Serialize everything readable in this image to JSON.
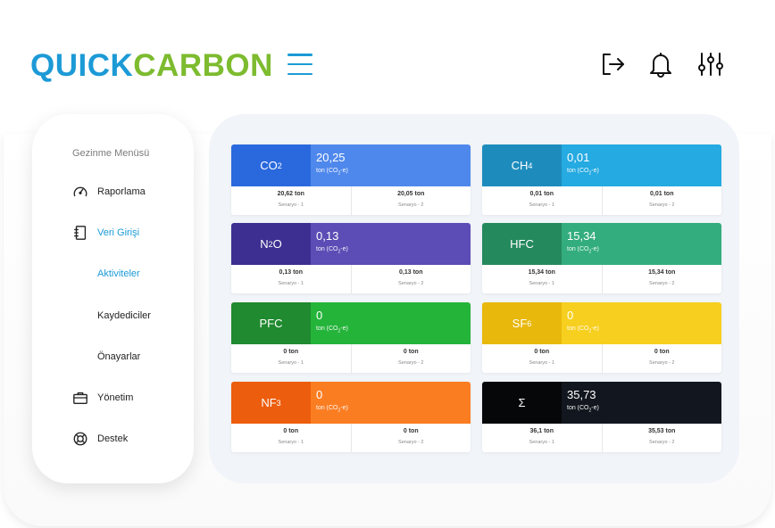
{
  "brand": {
    "part1": "QUICK",
    "part2": "CARBON",
    "color1": "#1c9ad6",
    "color2": "#7dbb2f"
  },
  "header_icons": [
    "logout-icon",
    "bell-icon",
    "sliders-icon"
  ],
  "sidebar": {
    "title": "Gezinme Menüsü",
    "items": [
      {
        "label": "Raporlama",
        "icon": "speedometer-icon"
      },
      {
        "label": "Veri Girişi",
        "icon": "notebook-icon"
      },
      {
        "label": "Aktiviteler"
      },
      {
        "label": "Kaydediciler"
      },
      {
        "label": "Önayarlar"
      },
      {
        "label": "Yönetim",
        "icon": "briefcase-icon"
      },
      {
        "label": "Destek",
        "icon": "lifebuoy-icon"
      }
    ]
  },
  "unit": "ton (CO₂-e)",
  "scenario1": "Senaryo - 1",
  "scenario2": "Senaryo - 2",
  "cards": [
    {
      "name": "CO",
      "sub": "2",
      "value": "20,25",
      "s1": "20,62 ton",
      "s2": "20,05 ton",
      "dark": "#2a69dd",
      "light": "#4f88ec"
    },
    {
      "name": "CH",
      "sub": "4",
      "value": "0,01",
      "s1": "0,01 ton",
      "s2": "0,01 ton",
      "dark": "#1d8cbd",
      "light": "#25aae1"
    },
    {
      "name": "N",
      "sub": "2",
      "name2": "O",
      "value": "0,13",
      "s1": "0,13 ton",
      "s2": "0,13 ton",
      "dark": "#3c2f91",
      "light": "#5b4db5"
    },
    {
      "name": "HFC",
      "value": "15,34",
      "s1": "15,34 ton",
      "s2": "15,34 ton",
      "dark": "#25895e",
      "light": "#33ad7d"
    },
    {
      "name": "PFC",
      "value": "0",
      "s1": "0 ton",
      "s2": "0 ton",
      "dark": "#1f8a2f",
      "light": "#24b43a"
    },
    {
      "name": "SF",
      "sub": "6",
      "value": "0",
      "s1": "0 ton",
      "s2": "0 ton",
      "dark": "#e8b80c",
      "light": "#f7cf1f"
    },
    {
      "name": "NF",
      "sub": "3",
      "value": "0",
      "s1": "0 ton",
      "s2": "0 ton",
      "dark": "#ec5d0d",
      "light": "#fb7d22"
    },
    {
      "name": "Σ",
      "value": "35,73",
      "s1": "36,1 ton",
      "s2": "35,53 ton",
      "dark": "#050709",
      "light": "#12171f"
    }
  ]
}
